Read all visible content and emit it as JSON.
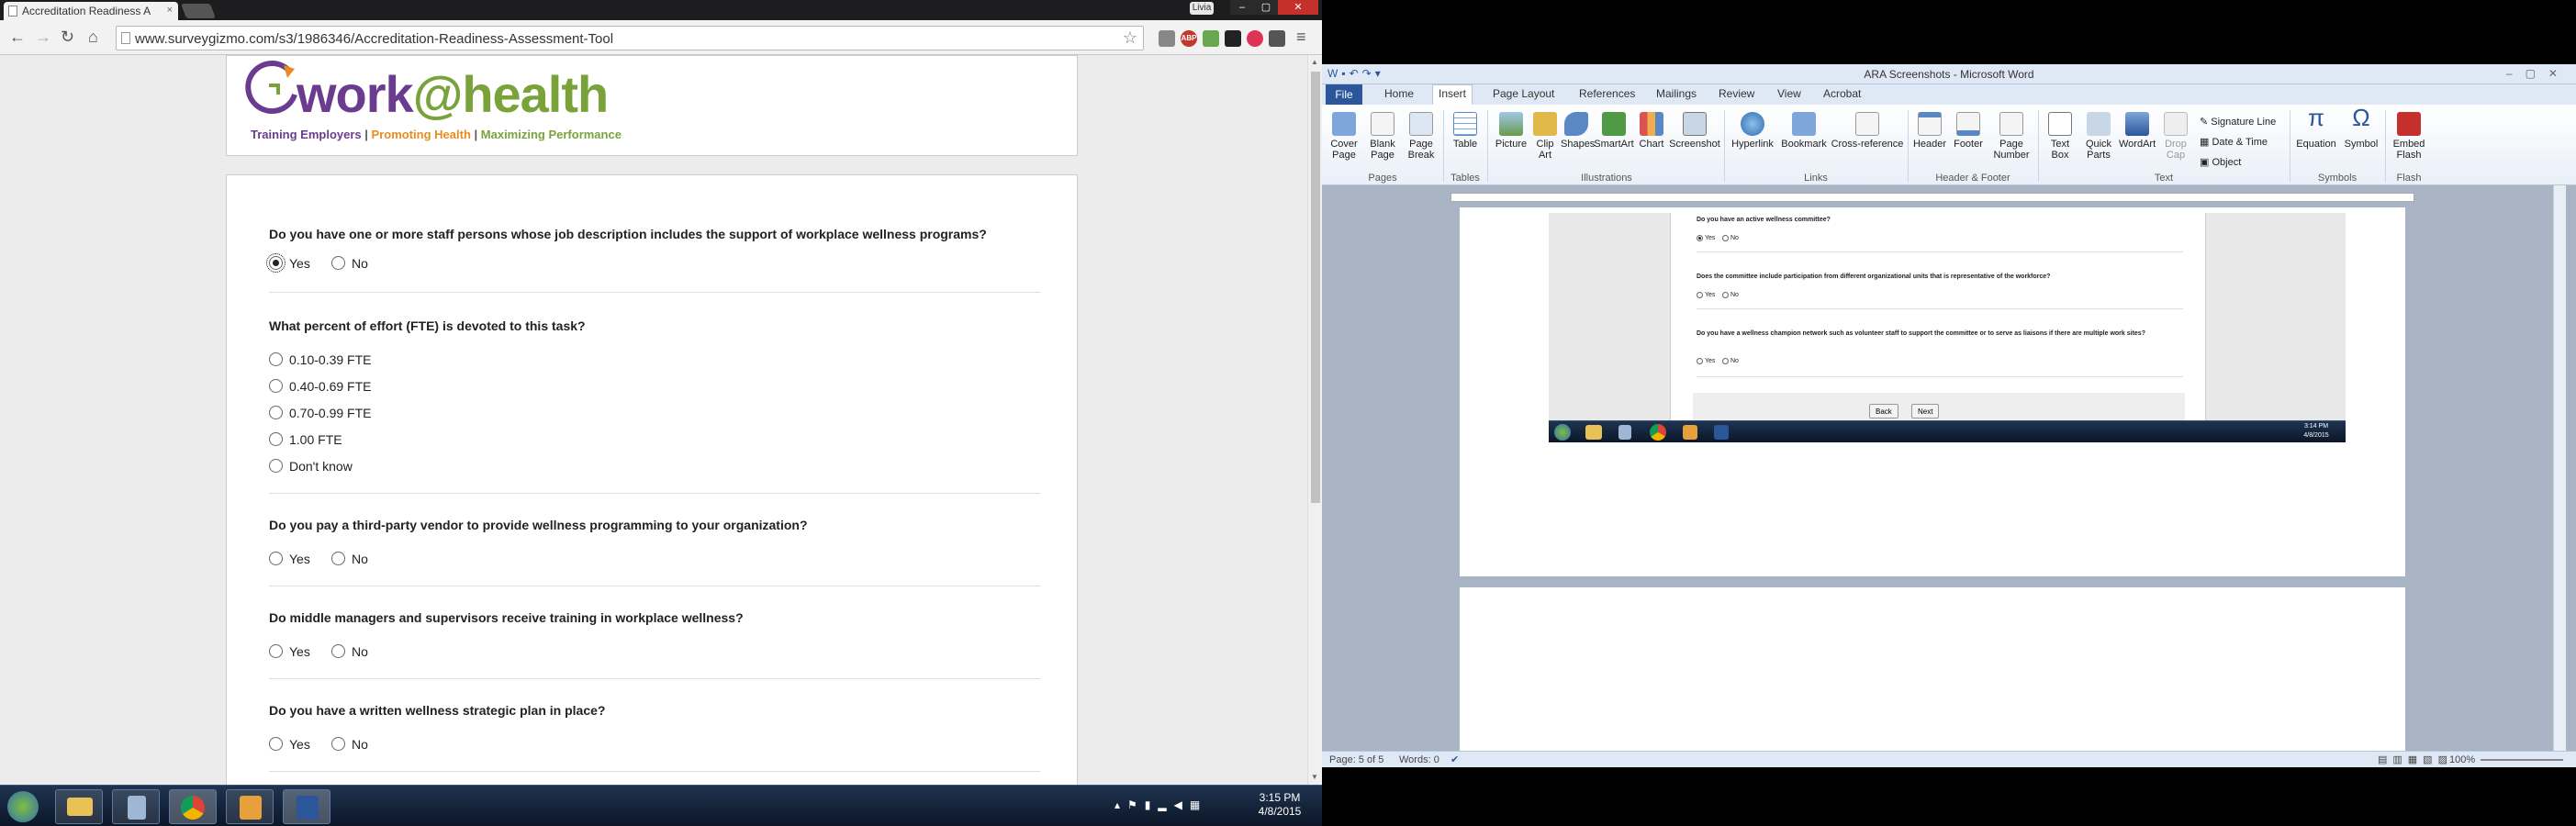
{
  "browser": {
    "tab_title": "Accreditation Readiness A",
    "tab_close": "×",
    "user_badge": "Livia",
    "url": "www.surveygizmo.com/s3/1986346/Accreditation-Readiness-Assessment-Tool",
    "ext_abp": "ABP"
  },
  "logo": {
    "work": "work",
    "at": "@",
    "health": "health",
    "tag1": "Training Employers",
    "tag2": "Promoting Health",
    "tag3": "Maximizing Performance",
    "sep": "|",
    "colors": {
      "purple": "#6a3b8f",
      "orange": "#e98b1f",
      "green": "#7aa23a"
    }
  },
  "survey": {
    "q1": "Do you have one or more staff persons whose job description includes the support of workplace wellness programs?",
    "q1_yes": "Yes",
    "q1_no": "No",
    "q2": "What percent of effort (FTE) is devoted to this task?",
    "q2_options": [
      "0.10-0.39 FTE",
      "0.40-0.69 FTE",
      "0.70-0.99 FTE",
      "1.00 FTE",
      "Don't know"
    ],
    "q3": "Do you pay a third-party vendor to provide wellness programming to your organization?",
    "q3_yes": "Yes",
    "q3_no": "No",
    "q4": "Do middle managers and supervisors receive training in workplace wellness?",
    "q4_yes": "Yes",
    "q4_no": "No",
    "q5": "Do you have a written wellness strategic plan in place?",
    "q5_yes": "Yes",
    "q5_no": "No"
  },
  "taskbar_left": {
    "time": "3:15 PM",
    "date": "4/8/2015"
  },
  "word": {
    "window_title": "ARA Screenshots - Microsoft Word",
    "file_tab": "File",
    "tabs": [
      "Home",
      "Insert",
      "Page Layout",
      "References",
      "Mailings",
      "Review",
      "View",
      "Acrobat"
    ],
    "ribbon": {
      "cover_page": "Cover Page",
      "blank_page": "Blank Page",
      "page_break": "Page Break",
      "table": "Table",
      "picture": "Picture",
      "clip_art": "Clip Art",
      "shapes": "Shapes",
      "smartart": "SmartArt",
      "chart": "Chart",
      "screenshot": "Screenshot",
      "hyperlink": "Hyperlink",
      "bookmark": "Bookmark",
      "cross_reference": "Cross-reference",
      "header": "Header",
      "footer": "Footer",
      "page_number": "Page Number",
      "text_box": "Text Box",
      "quick_parts": "Quick Parts",
      "wordart": "WordArt",
      "drop_cap": "Drop Cap",
      "signature_line": "Signature Line",
      "date_time": "Date & Time",
      "object": "Object",
      "equation": "Equation",
      "symbol": "Symbol",
      "embed_flash": "Embed Flash"
    },
    "groups": {
      "pages": "Pages",
      "tables": "Tables",
      "illustrations": "Illustrations",
      "links": "Links",
      "header_footer": "Header & Footer",
      "text": "Text",
      "symbols": "Symbols",
      "flash": "Flash"
    },
    "embedded": {
      "q1": "Do you have an active wellness committee?",
      "q2": "Does the committee include participation from different organizational units that is representative of the workforce?",
      "q3": "Do you have a wellness champion network such as volunteer staff to support the committee or to serve as liaisons if there are multiple work sites?",
      "yes": "Yes",
      "no": "No",
      "back": "Back",
      "next": "Next",
      "time": "3:14 PM",
      "date": "4/8/2015"
    },
    "status": {
      "page": "Page: 5 of 5",
      "words": "Words: 0",
      "zoom": "100%"
    }
  }
}
